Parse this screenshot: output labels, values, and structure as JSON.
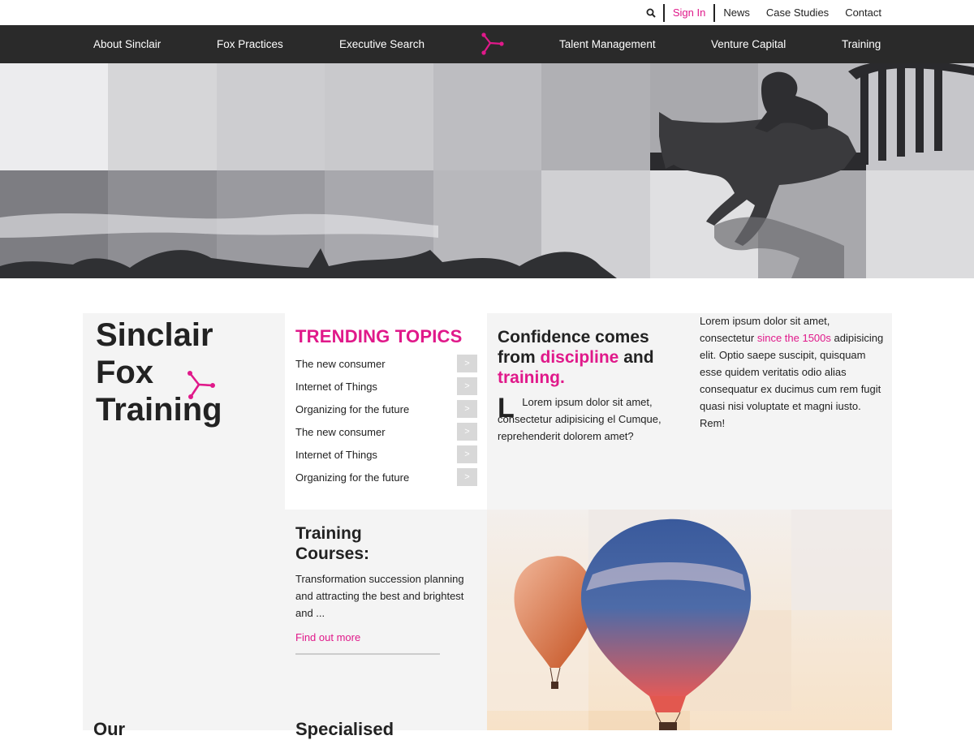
{
  "utility_nav": {
    "sign_in": "Sign In",
    "links": [
      "News",
      "Case Studies",
      "Contact"
    ]
  },
  "main_nav": {
    "items": [
      "About Sinclair",
      "Fox Practices",
      "Executive Search",
      "Talent Management",
      "Venture Capital",
      "Training"
    ]
  },
  "brand": {
    "lines": [
      "Sinclair",
      "Fox",
      "Training"
    ],
    "bottom_heading": "Our"
  },
  "trending": {
    "title": "TRENDING TOPICS",
    "items": [
      "The new consumer",
      "Internet of Things",
      "Organizing for the future",
      "The new consumer",
      "Internet of Things",
      "Organizing for the future"
    ],
    "arrow": ">"
  },
  "courses": {
    "title_line1": "Training",
    "title_line2": "Courses:",
    "text": "Transformation succession planning and attracting the best and brightest and ...",
    "link": "Find out more",
    "bottom_heading": "Specialised"
  },
  "confidence": {
    "h_part1": "Confidence comes from ",
    "h_pink1": "discipline",
    "h_part2": " and ",
    "h_pink2": "training.",
    "dropcap": "L",
    "para_first": "Lorem ipsum dolor sit amet,",
    "para_rest": "consectetur adipisicing el Cumque, reprehenderit dolorem amet?",
    "side_before": "Lorem ipsum dolor sit amet, consectetur ",
    "side_link": "since the 1500s",
    "side_after": " adipisicing elit. Optio saepe suscipit, quisquam esse quidem veritatis odio alias consequatur ex ducimus cum rem fugit quasi nisi voluptate et magni iusto. Rem!"
  },
  "colors": {
    "accent": "#e0198a",
    "nav_bg": "#2a2a2a",
    "panel_bg": "#f4f4f4"
  },
  "icons": {
    "search": "search-icon",
    "logo": "fox-logo-icon",
    "arrow": "chevron-right-icon"
  }
}
